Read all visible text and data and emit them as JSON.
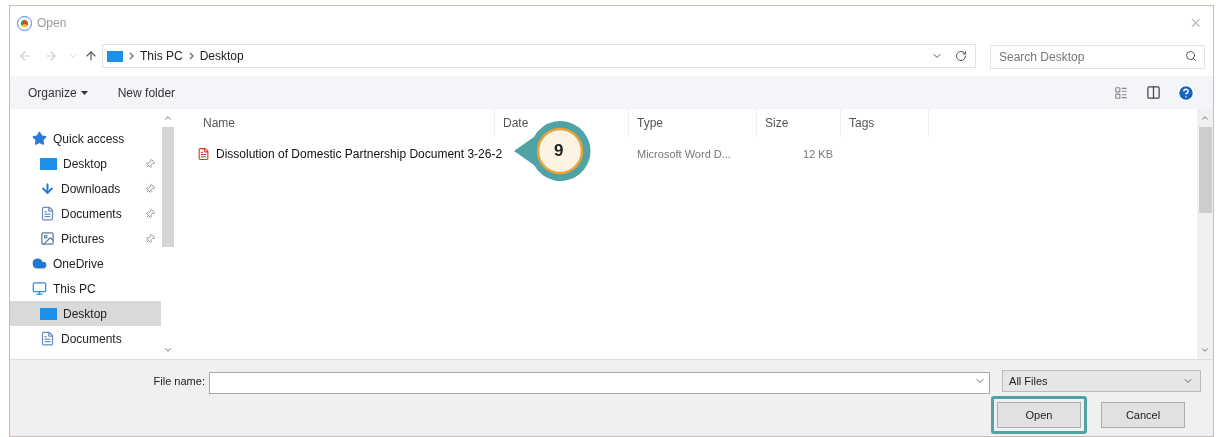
{
  "window": {
    "title": "Open",
    "close": "×"
  },
  "address": {
    "path": [
      "This PC",
      "Desktop"
    ]
  },
  "search": {
    "placeholder": "Search Desktop"
  },
  "toolbar": {
    "buttons": [
      "Organize",
      "New folder"
    ]
  },
  "sidebar": {
    "items": [
      {
        "label": "Quick access",
        "kind": "star",
        "selected": false,
        "children": [
          {
            "label": "Desktop",
            "kind": "desktop",
            "pinned": true,
            "selected": false
          },
          {
            "label": "Downloads",
            "kind": "download",
            "pinned": true,
            "selected": false
          },
          {
            "label": "Documents",
            "kind": "document",
            "pinned": true,
            "selected": false
          },
          {
            "label": "Pictures",
            "kind": "pictures",
            "pinned": true,
            "selected": false
          }
        ]
      },
      {
        "label": "OneDrive",
        "kind": "cloud",
        "selected": false
      },
      {
        "label": "This PC",
        "kind": "pc",
        "selected": false,
        "children": [
          {
            "label": "Desktop",
            "kind": "desktop",
            "pinned": false,
            "selected": true
          },
          {
            "label": "Documents",
            "kind": "document",
            "pinned": false,
            "selected": false
          }
        ]
      }
    ]
  },
  "table": {
    "columns": [
      "Name",
      "Date",
      "Type",
      "Size",
      "Tags"
    ],
    "rows": [
      {
        "name": "Dissolution of Domestic Partnership Document 3-26-2",
        "type": "Microsoft Word D...",
        "size": "12 KB"
      }
    ]
  },
  "callout": {
    "number": "9"
  },
  "file_name": {
    "label": "File name:"
  },
  "filter": {
    "value": "All Files"
  },
  "buttons": [
    {
      "label": "Open",
      "highlighted": true
    },
    {
      "label": "Cancel",
      "highlighted": false
    }
  ]
}
